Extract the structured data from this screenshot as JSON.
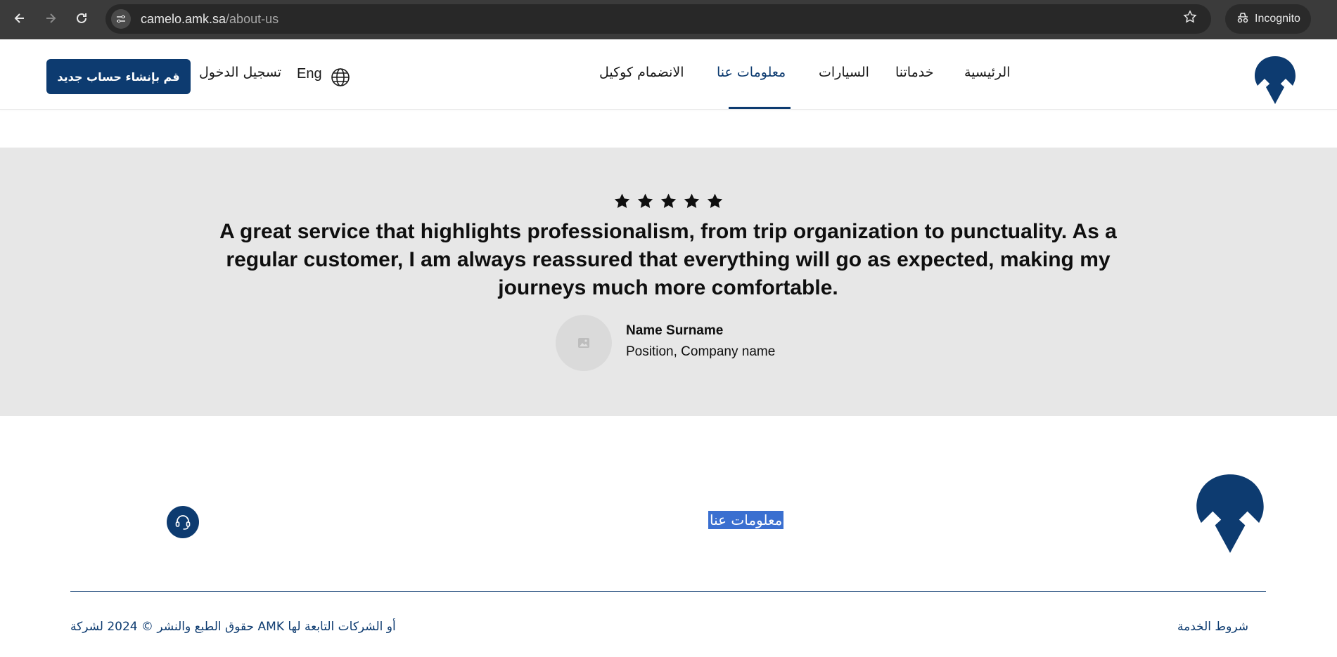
{
  "browser": {
    "url_host": "camelo.amk.sa",
    "url_path": "/about-us",
    "incognito_label": "Incognito"
  },
  "header": {
    "nav": [
      {
        "label": "الرئيسية"
      },
      {
        "label": "خدماتنا"
      },
      {
        "label": "السيارات"
      },
      {
        "label": "معلومات عنا",
        "active": true
      },
      {
        "label": "الانضمام كوكيل"
      }
    ],
    "lang_label": "Eng",
    "login_label": "تسجيل الدخول",
    "signup_label": "قم بإنشاء حساب جديد"
  },
  "testimonial": {
    "rating": 5,
    "quote": "A great service that highlights professionalism, from trip organization to punctuality. As a regular customer, I am always reassured that everything will go as expected, making my journeys much more comfortable.",
    "name": "Name Surname",
    "position": "Position, Company name"
  },
  "footer": {
    "link": "معلومات عنا",
    "terms": "شروط الخدمة",
    "copyright": "أو الشركات التابعة لها AMK حقوق الطبع والنشر © 2024 لشركة"
  },
  "colors": {
    "brand": "#0d3b70",
    "testimonial_bg": "#e7e7e7",
    "selection": "#3a6fd0"
  },
  "icons": [
    "back-icon",
    "forward-icon",
    "reload-icon",
    "site-info-icon",
    "star-icon",
    "incognito-icon",
    "globe-icon",
    "image-placeholder-icon",
    "headset-icon"
  ]
}
